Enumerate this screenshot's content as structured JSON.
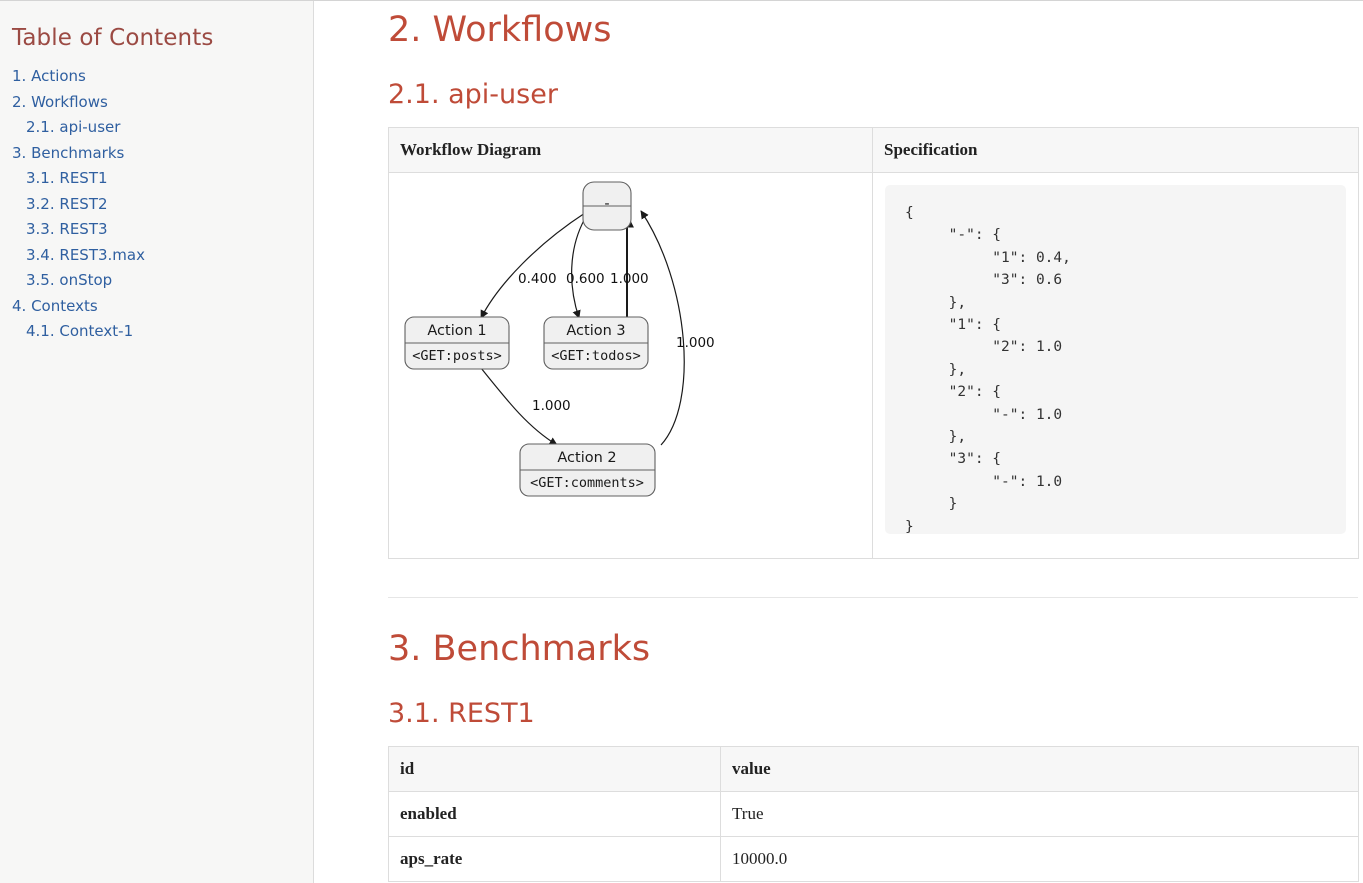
{
  "sidebar": {
    "title": "Table of Contents",
    "items": [
      {
        "label": "1. Actions",
        "level": 1
      },
      {
        "label": "2. Workflows",
        "level": 1
      },
      {
        "label": "2.1. api-user",
        "level": 2
      },
      {
        "label": "3. Benchmarks",
        "level": 1
      },
      {
        "label": "3.1. REST1",
        "level": 2
      },
      {
        "label": "3.2. REST2",
        "level": 2
      },
      {
        "label": "3.3. REST3",
        "level": 2
      },
      {
        "label": "3.4. REST3.max",
        "level": 2
      },
      {
        "label": "3.5. onStop",
        "level": 2
      },
      {
        "label": "4. Contexts",
        "level": 1
      },
      {
        "label": "4.1. Context-1",
        "level": 2
      }
    ]
  },
  "main": {
    "workflows_heading": "2. Workflows",
    "api_user_heading": "2.1. api-user",
    "benchmarks_heading": "3. Benchmarks",
    "rest1_heading": "3.1. REST1"
  },
  "workflow_table": {
    "headers": [
      "Workflow Diagram",
      "Specification"
    ],
    "specification": "{\n     \"-\": {\n          \"1\": 0.4,\n          \"3\": 0.6\n     },\n     \"1\": {\n          \"2\": 1.0\n     },\n     \"2\": {\n          \"-\": 1.0\n     },\n     \"3\": {\n          \"-\": 1.0\n     }\n}"
  },
  "diagram": {
    "nodes": [
      {
        "id": "root",
        "title": "-",
        "subtitle": ""
      },
      {
        "id": "1",
        "title": "Action 1",
        "subtitle": "<GET:posts>"
      },
      {
        "id": "3",
        "title": "Action 3",
        "subtitle": "<GET:todos>"
      },
      {
        "id": "2",
        "title": "Action 2",
        "subtitle": "<GET:comments>"
      }
    ],
    "edges": [
      {
        "from": "root",
        "to": "1",
        "label": "0.400"
      },
      {
        "from": "root",
        "to": "3",
        "label": "0.600"
      },
      {
        "from": "3",
        "to": "root",
        "label": "1.000"
      },
      {
        "from": "2",
        "to": "root",
        "label": "1.000"
      },
      {
        "from": "1",
        "to": "2",
        "label": "1.000"
      }
    ]
  },
  "bench_table": {
    "headers": [
      "id",
      "value"
    ],
    "rows": [
      {
        "id": "enabled",
        "value": "True"
      },
      {
        "id": "aps_rate",
        "value": "10000.0"
      }
    ]
  },
  "colors": {
    "heading": "#bf4b38",
    "link": "#2f5fa0",
    "toc_title": "#9b4a43",
    "sidebar_bg": "#f7f7f6",
    "code_bg": "#f5f5f5"
  }
}
